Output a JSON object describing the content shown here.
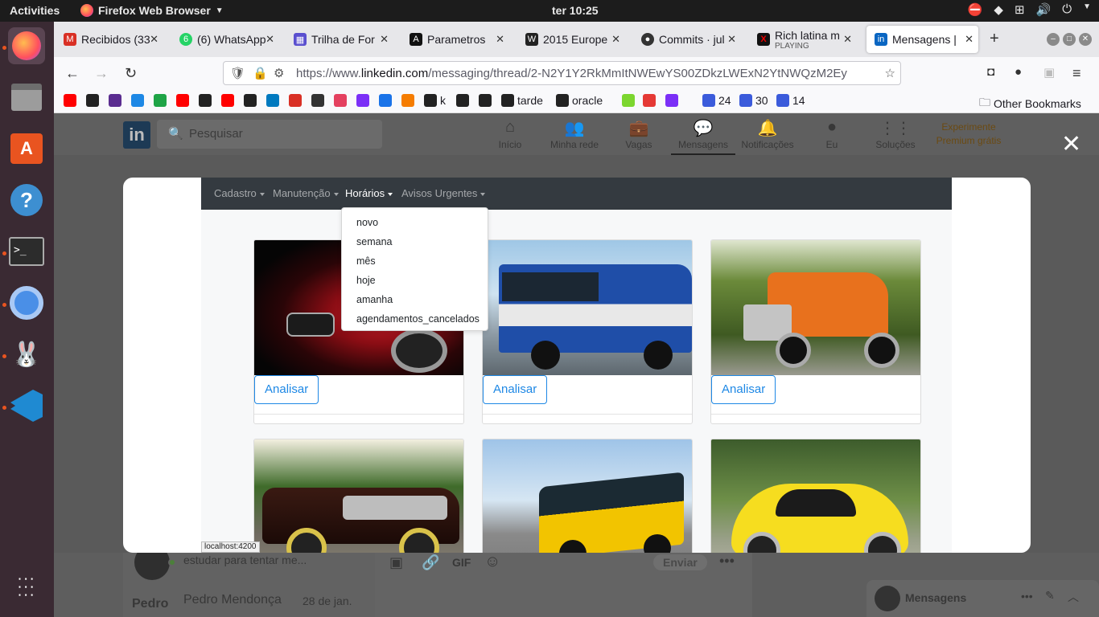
{
  "desktop": {
    "activities": "Activities",
    "app_name": "Firefox Web Browser",
    "clock": "ter 10:25"
  },
  "browser": {
    "tabs": [
      {
        "label": "Recibidos (33",
        "icon": "gmail-icon",
        "color": "#d93025"
      },
      {
        "label": "(6) WhatsApp",
        "icon": "whatsapp-icon",
        "color": "#25d366"
      },
      {
        "label": "Trilha de For",
        "icon": "trello-like-icon",
        "color": "#5a4fcf"
      },
      {
        "label": "Parametros",
        "icon": "angular-icon",
        "color": "#111"
      },
      {
        "label": "2015 Europe",
        "icon": "wikipedia-icon",
        "color": "#222"
      },
      {
        "label": "Commits · jul",
        "icon": "github-icon",
        "color": "#333"
      },
      {
        "label": "Rich latina m",
        "sub": "PLAYING",
        "icon": "x-icon",
        "color": "#d00"
      },
      {
        "label": "Mensagens |",
        "icon": "linkedin-icon",
        "color": "#0a66c2"
      }
    ],
    "url_prefix": "https://www.",
    "url_domain": "linkedin.com",
    "url_rest": "/messaging/thread/2-N2Y1Y2RkMmItNWEwYS00ZDkzLWExN2YtNWQzM2Ey",
    "bookmarks": [
      {
        "label": "",
        "color": "#ff0000"
      },
      {
        "label": "",
        "color": "#222"
      },
      {
        "label": "",
        "color": "#5b2d90"
      },
      {
        "label": "",
        "color": "#1e88e5"
      },
      {
        "label": "",
        "color": "#1ea446"
      },
      {
        "label": "",
        "color": "#ff0000"
      },
      {
        "label": "",
        "color": "#222"
      },
      {
        "label": "",
        "color": "#ff0000"
      },
      {
        "label": "",
        "color": "#222"
      },
      {
        "label": "",
        "color": "#0079bf"
      },
      {
        "label": "",
        "color": "#d93025"
      },
      {
        "label": "",
        "color": "#333"
      },
      {
        "label": "",
        "color": "#e4405f"
      },
      {
        "label": "",
        "color": "#7b2ff7"
      },
      {
        "label": "",
        "color": "#1a73e8"
      },
      {
        "label": "",
        "color": "#f57c00"
      },
      {
        "label": "k",
        "color": "#222"
      },
      {
        "label": "",
        "color": "#222"
      },
      {
        "label": "",
        "color": "#222"
      },
      {
        "label": "tarde",
        "color": "#222"
      },
      {
        "label": "oracle",
        "color": "#222"
      },
      {
        "label": "",
        "color": "#7cd62f"
      },
      {
        "label": "",
        "color": "#e53935"
      },
      {
        "label": "",
        "color": "#7b2ff7"
      },
      {
        "label": "24",
        "color": "#3b5bdb"
      },
      {
        "label": "30",
        "color": "#3b5bdb"
      },
      {
        "label": "14",
        "color": "#3b5bdb"
      }
    ],
    "other_bookmarks": "Other Bookmarks",
    "status_url": "localhost:4200"
  },
  "linkedin": {
    "logo": "in",
    "search_placeholder": "Pesquisar",
    "nav": [
      {
        "label": "Início",
        "icon": "home-icon",
        "glyph": "⌂"
      },
      {
        "label": "Minha rede",
        "icon": "network-icon",
        "glyph": "👥"
      },
      {
        "label": "Vagas",
        "icon": "briefcase-icon",
        "glyph": "💼"
      },
      {
        "label": "Mensagens",
        "icon": "messages-icon",
        "glyph": "💬"
      },
      {
        "label": "Notificações",
        "icon": "bell-icon",
        "glyph": "🔔"
      },
      {
        "label": "Eu",
        "icon": "avatar-icon",
        "glyph": "●"
      },
      {
        "label": "Soluções",
        "icon": "grid-icon",
        "glyph": "⋮⋮"
      }
    ],
    "premium": "Experimente Premium grátis",
    "behind": {
      "snippet": "estudar para tentar me...",
      "sender_short": "Pedro",
      "sender_full": "Pedro Mendonça",
      "date": "28 de jan.",
      "gif": "GIF",
      "send": "Enviar",
      "messages_bar": "Mensagens"
    }
  },
  "app": {
    "menus": [
      {
        "label": "Cadastro"
      },
      {
        "label": "Manutenção"
      },
      {
        "label": "Horários"
      },
      {
        "label": "Avisos Urgentes"
      }
    ],
    "dropdown_items": [
      "novo",
      "semana",
      "mês",
      "hoje",
      "amanha",
      "agendamentos_cancelados"
    ],
    "button_label": "Analisar",
    "cards": [
      {
        "subject": "red-audi-car"
      },
      {
        "subject": "blue-city-bus"
      },
      {
        "subject": "orange-truck"
      },
      {
        "subject": "classic-lowrider-car"
      },
      {
        "subject": "yellow-school-bus"
      },
      {
        "subject": "yellow-beetle-car"
      }
    ]
  }
}
